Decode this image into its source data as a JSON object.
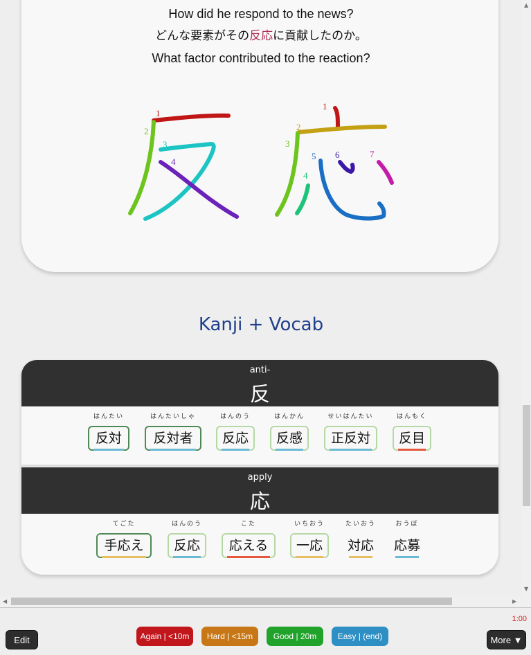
{
  "sentences": {
    "en_question": "How did he respond to the news?",
    "jp_before": "どんな要素がその",
    "jp_highlight": "反応",
    "jp_after": "に貢献したのか。",
    "en_translation": "What factor contributed to the reaction?"
  },
  "stroke_order": {
    "kanji1": {
      "char": "反",
      "stroke_numbers": [
        "1",
        "2",
        "3",
        "4"
      ]
    },
    "kanji2": {
      "char": "応",
      "stroke_numbers": [
        "1",
        "2",
        "3",
        "4",
        "5",
        "6",
        "7"
      ]
    }
  },
  "section_title": "Kanji + Vocab",
  "kanji_blocks": [
    {
      "meaning": "anti-",
      "kanji": "反",
      "vocab": [
        {
          "word": "反対",
          "reading": "はんたい"
        },
        {
          "word": "反対者",
          "reading": "はんたいしゃ"
        },
        {
          "word": "反応",
          "reading": "はんのう"
        },
        {
          "word": "反感",
          "reading": "はんかん"
        },
        {
          "word": "正反対",
          "reading": "せいはんたい"
        },
        {
          "word": "反目",
          "reading": "はんもく"
        }
      ]
    },
    {
      "meaning": "apply",
      "kanji": "応",
      "vocab": [
        {
          "word": "手応え",
          "reading": "てごた"
        },
        {
          "word": "反応",
          "reading": "はんのう"
        },
        {
          "word": "応える",
          "reading": "こた"
        },
        {
          "word": "一応",
          "reading": "いちおう"
        },
        {
          "word": "対応",
          "reading": "たいおう"
        },
        {
          "word": "応募",
          "reading": "おうぼ"
        }
      ]
    }
  ],
  "bottom_bar": {
    "timer": "1:00",
    "edit_label": "Edit",
    "more_label": "More ▼",
    "again_label": "Again | <10m",
    "hard_label": "Hard | <15m",
    "good_label": "Good | 20m",
    "easy_label": "Easy | (end)"
  },
  "colors": {
    "again": "#c0161c",
    "hard": "#c77716",
    "good": "#21a32b",
    "easy": "#2d8fc4",
    "section_title": "#1f3f8a",
    "highlight": "#b03058"
  }
}
